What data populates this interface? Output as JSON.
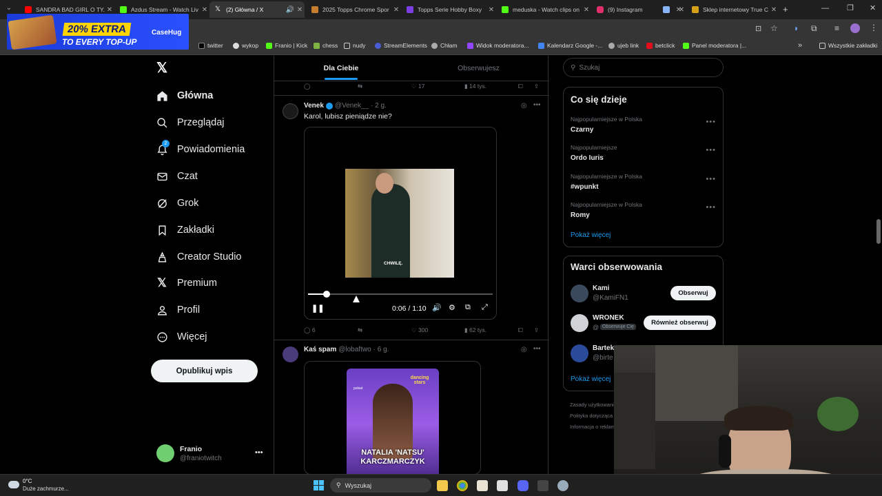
{
  "browser": {
    "tabs": [
      {
        "title": "SANDRA BAD GIRL O TY...",
        "color": "#ff0000"
      },
      {
        "title": "Azdus Stream - Watch Liv",
        "color": "#53fc18"
      },
      {
        "title": "(2) Główna / X",
        "color": "#ffffff"
      },
      {
        "title": "2025 Topps Chrome Spor",
        "color": "#c77d2e"
      },
      {
        "title": "Topps Serie Hobby Boxy",
        "color": "#7b3fe4"
      },
      {
        "title": "meduska - Watch clips on",
        "color": "#53fc18"
      },
      {
        "title": "(9) Instagram",
        "color": "#e1306c"
      },
      {
        "title": "",
        "color": "#8ab4f8"
      },
      {
        "title": "Sklep internetowy True C",
        "color": "#d4a017"
      }
    ],
    "bookmarks": [
      "twitter",
      "wykop",
      "Franio | Kick",
      "chess",
      "nudy",
      "StreamElements",
      "Chłam",
      "Widok moderatora...",
      "Kalendarz Google -...",
      "ujeb link",
      "betclick",
      "Panel moderatora |...",
      "Wszystkie zakładki"
    ],
    "ad": {
      "line1": "20% EXTRA",
      "line2": "TO EVERY TOP-UP",
      "brand": "CaseHug"
    }
  },
  "nav": {
    "items": [
      "Główna",
      "Przeglądaj",
      "Powiadomienia",
      "Czat",
      "Grok",
      "Zakładki",
      "Creator Studio",
      "Premium",
      "Profil",
      "Więcej"
    ],
    "notif_badge": "2",
    "post_button": "Opublikuj wpis",
    "user_name": "Franio",
    "user_handle": "@franiotwitch"
  },
  "feed": {
    "tabs": [
      "Dla Ciebie",
      "Obserwujesz"
    ],
    "top_actions": {
      "likes": "17",
      "views": "14 tys."
    },
    "tweet1": {
      "name": "Venek",
      "handle": "@Venek__",
      "time": "· 2 g.",
      "text": "Karol, lubisz pieniądze nie?",
      "caption": "CHWILĘ.",
      "video_time": "0:06 / 1:10",
      "progress": 0.1,
      "replies": "6",
      "likes": "300",
      "views": "62 tys."
    },
    "tweet2": {
      "name": "Kaś spam",
      "handle": "@lobaftwo",
      "time": "· 6 g.",
      "poster_brand": "dancing stars",
      "poster_sub": "polsat",
      "poster_name1": "NATALIA 'NATSU'",
      "poster_name2": "KARCZMARCZYK"
    }
  },
  "search": {
    "placeholder": "Szukaj"
  },
  "trends": {
    "title": "Co się dzieje",
    "items": [
      {
        "meta": "Najpopularniejsze w Polska",
        "topic": "Czarny"
      },
      {
        "meta": "Najpopularniejsze",
        "topic": "Ordo Iuris"
      },
      {
        "meta": "Najpopularniejsze w Polska",
        "topic": "#wpunkt"
      },
      {
        "meta": "Najpopularniejsze w Polska",
        "topic": "Romy"
      }
    ],
    "more": "Pokaż więcej"
  },
  "who_to_follow": {
    "title": "Warci obserwowania",
    "users": [
      {
        "name": "Kami",
        "handle": "@KamiFN1",
        "button": "Obserwuj",
        "badge": ""
      },
      {
        "name": "WRONEK",
        "handle": "@",
        "button": "Również obserwuj",
        "badge": "Obserwuje Cię"
      },
      {
        "name": "Bartek",
        "handle": "@birte",
        "button": "",
        "badge": ""
      }
    ],
    "more": "Pokaż więcej"
  },
  "footer_links": [
    "Zasady użytkowania",
    "Polityka dotycząca",
    "Informacja o reklam"
  ],
  "taskbar": {
    "temp": "0°C",
    "weather": "Duże zachmurze...",
    "search": "Wyszukaj"
  },
  "colors": {
    "accent": "#1d9bf0",
    "bg": "#000000",
    "border": "#2f3336"
  }
}
